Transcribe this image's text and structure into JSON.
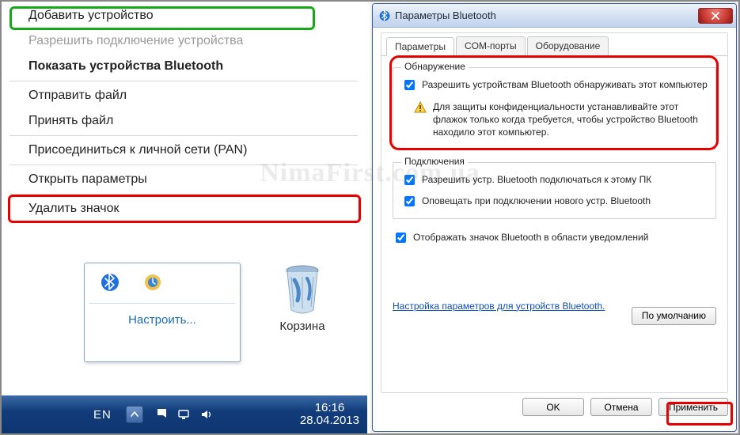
{
  "context_menu": {
    "add_device": "Добавить устройство",
    "allow_conn": "Разрешить подключение устройства",
    "show_devices": "Показать устройства Bluetooth",
    "send_file": "Отправить файл",
    "receive_file": "Принять файл",
    "join_pan": "Присоединиться к личной сети (PAN)",
    "open_settings": "Открыть параметры",
    "remove_icon": "Удалить значок"
  },
  "tray": {
    "customize": "Настроить..."
  },
  "desktop": {
    "recycle_bin": "Корзина"
  },
  "taskbar": {
    "lang": "EN",
    "time": "16:16",
    "date": "28.04.2013"
  },
  "dialog": {
    "title": "Параметры Bluetooth",
    "tabs": {
      "params": "Параметры",
      "com": "COM-порты",
      "hw": "Оборудование"
    },
    "group_discovery": {
      "title": "Обнаружение",
      "allow_discover": "Разрешить устройствам Bluetooth обнаруживать этот компьютер",
      "warning": "Для защиты конфиденциальности устанавливайте этот флажок только когда требуется, чтобы устройство Bluetooth находило этот компьютер."
    },
    "group_conn": {
      "title": "Подключения",
      "allow_connect": "Разрешить устр. Bluetooth подключаться к этому ПК",
      "notify_new": "Оповещать при подключении нового устр. Bluetooth"
    },
    "show_tray_icon": "Отображать значок Bluetooth в области уведомлений",
    "link": "Настройка параметров для устройств Bluetooth.",
    "default_btn": "По умолчанию",
    "ok": "OK",
    "cancel": "Отмена",
    "apply": "Применить"
  },
  "watermark": "NimaFirst.com.ua"
}
